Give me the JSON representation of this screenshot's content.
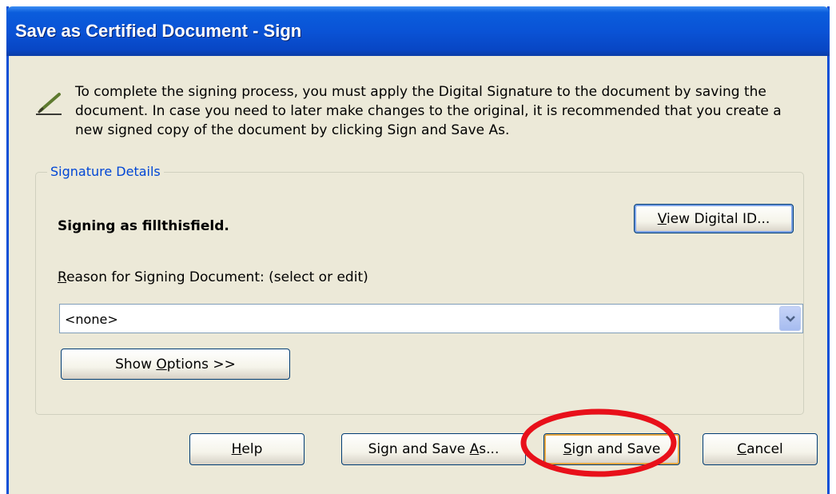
{
  "window": {
    "title": "Save as Certified Document - Sign"
  },
  "intro": {
    "text": "To complete the signing process, you must apply the Digital Signature to the document by saving the document. In case you need to later make changes to the original, it is recommended that you create a new signed copy of the document by clicking Sign and Save As."
  },
  "details": {
    "legend": "Signature Details",
    "signing_as": "Signing as fillthisfield.",
    "view_id": {
      "mnemonic": "V",
      "rest": "iew Digital ID..."
    },
    "reason_label": {
      "mnemonic": "R",
      "rest": "eason for Signing Document: (select or edit)"
    },
    "reason_value": "<none>",
    "show_options": {
      "before": "Show ",
      "mnemonic": "O",
      "rest": "ptions >>"
    }
  },
  "buttons": {
    "help": {
      "mnemonic": "H",
      "rest": "elp"
    },
    "sign_save_as": {
      "before": "Sign and Save ",
      "mnemonic": "A",
      "rest": "s..."
    },
    "sign_save": {
      "mnemonic": "S",
      "rest": "ign and Save"
    },
    "cancel": {
      "mnemonic": "C",
      "rest": "ancel"
    }
  },
  "annotation": {
    "color": "#e8101a",
    "target": "Sign and Save"
  },
  "icons": {
    "intro": "pencil-icon",
    "dropdown": "chevron-down-icon"
  }
}
